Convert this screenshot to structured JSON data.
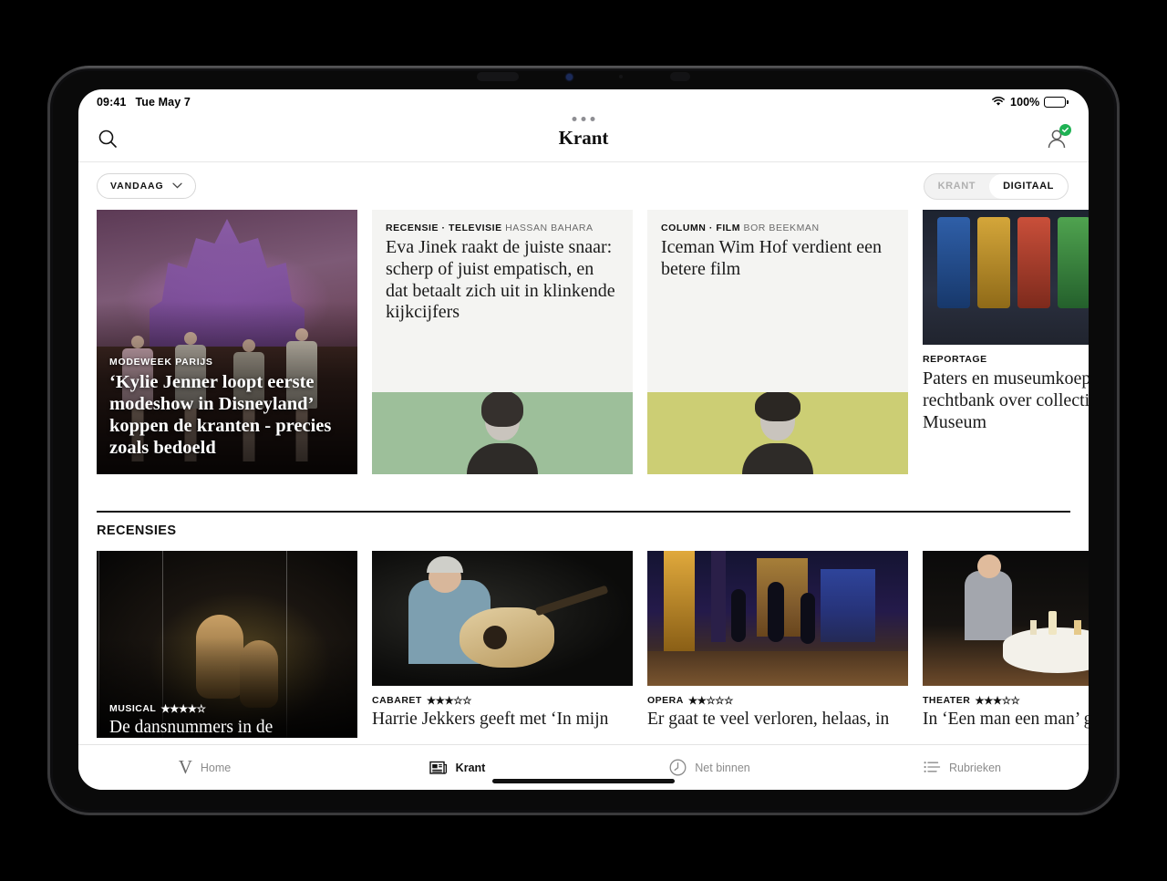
{
  "status_bar": {
    "time": "09:41",
    "date": "Tue May 7",
    "battery_percent": "100%",
    "wifi_icon": "wifi-icon",
    "battery_icon": "battery-icon"
  },
  "nav": {
    "title": "Krant",
    "search_icon": "search-icon",
    "account_icon": "account-icon",
    "account_badge_icon": "check-badge-icon"
  },
  "filters": {
    "date_chip_label": "VANDAAG",
    "date_chip_icon": "chevron-down-icon",
    "segmented": [
      {
        "label": "KRANT",
        "active": false
      },
      {
        "label": "DIGITAAL",
        "active": true
      }
    ]
  },
  "top_grid": [
    {
      "type": "hero",
      "kicker": "MODEWEEK PARIJS",
      "headline": "‘Kylie Jenner loopt eerste modeshow in Disneyland’ koppen de kranten - precies zoals bedoeld",
      "image_name": "fashion-show-disneyland-photo"
    },
    {
      "type": "text-with-portrait",
      "kicker_category": "RECENSIE · TELEVISIE",
      "kicker_byline": "HASSAN BAHARA",
      "headline": "Eva Jinek raakt de juiste snaar: scherp of juist empatisch, en dat betaalt zich uit in klinkende kijkcijfers",
      "portrait_bg": "#9dbf9a",
      "image_name": "hassan-bahara-portrait"
    },
    {
      "type": "text-with-portrait",
      "kicker_category": "COLUMN · FILM",
      "kicker_byline": "BOR BEEKMAN",
      "headline": "Iceman Wim Hof verdient een betere film",
      "portrait_bg": "#ccce74",
      "image_name": "bor-beekman-portrait"
    },
    {
      "type": "photo-top",
      "kicker_category": "REPORTAGE",
      "kicker_byline": "",
      "headline": "Paters en museumkoepel in rechtbank over collectie Afrika Museum",
      "image_name": "afrika-museum-textiles-photo"
    }
  ],
  "recensies": {
    "section_title": "RECENSIES",
    "cards": [
      {
        "category": "MUSICAL",
        "rating": 4,
        "max_rating": 5,
        "stars": "★★★★☆",
        "headline": "De dansnummers in de",
        "overlay": true,
        "image_name": "musical-dancers-photo"
      },
      {
        "category": "CABARET",
        "rating": 3,
        "max_rating": 5,
        "stars": "★★★☆☆",
        "headline": "Harrie Jekkers geeft met ‘In mijn",
        "overlay": false,
        "image_name": "harrie-jekkers-guitar-photo"
      },
      {
        "category": "OPERA",
        "rating": 2,
        "max_rating": 5,
        "stars": "★★☆☆☆",
        "headline": "Er gaat te veel verloren, helaas, in",
        "overlay": false,
        "image_name": "opera-stage-photo"
      },
      {
        "category": "THEATER",
        "rating": 3,
        "max_rating": 5,
        "stars": "★★★☆☆",
        "headline": "In ‘Een man een man’ g",
        "overlay": false,
        "image_name": "theater-dinner-scene-photo"
      }
    ]
  },
  "tab_bar": [
    {
      "label": "Home",
      "icon": "volkskrant-v-logo-icon",
      "active": false
    },
    {
      "label": "Krant",
      "icon": "newspaper-icon",
      "active": true
    },
    {
      "label": "Net binnen",
      "icon": "clock-icon",
      "active": false
    },
    {
      "label": "Rubrieken",
      "icon": "list-icon",
      "active": false
    }
  ],
  "colors": {
    "accent_green": "#1fb254",
    "portrait_green": "#9dbf9a",
    "portrait_olive": "#ccce74",
    "card_gray": "#f4f4f2",
    "text_primary": "#111111",
    "text_muted": "#8b8b8b"
  }
}
